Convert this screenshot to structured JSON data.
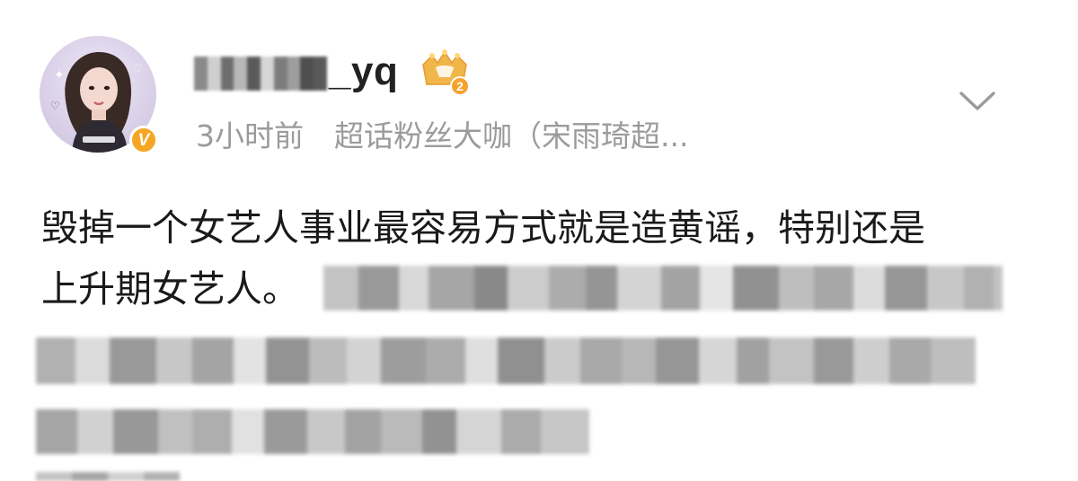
{
  "post": {
    "username_suffix": "_yq",
    "time": "3小时前",
    "source": "超话粉丝大咖（宋雨琦超...",
    "verified_glyph": "V",
    "member_level": "2",
    "text_line1": "毁掉一个女艺人事业最容易方式就是造黄谣，特别还是",
    "text_line2": "上升期女艺人。"
  },
  "icons": {
    "avatar": "avatar-image",
    "verified": "verified-icon",
    "member": "crown-member-icon",
    "more": "chevron-down-icon"
  },
  "colors": {
    "text": "#1a1a1a",
    "meta": "#9b9b9b",
    "badge": "#f5a623",
    "crown": "#f0b64a"
  }
}
